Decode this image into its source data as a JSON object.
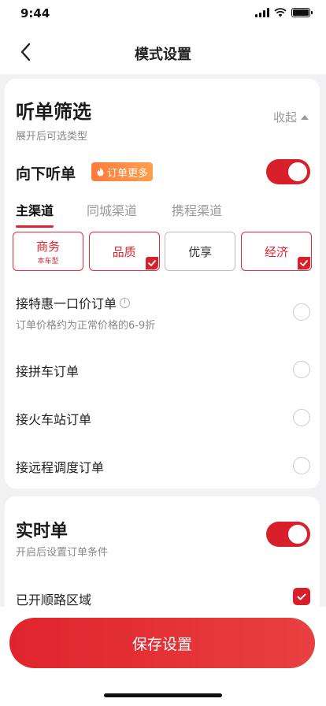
{
  "status_bar": {
    "time": "9:44"
  },
  "header": {
    "title": "模式设置"
  },
  "filter": {
    "title": "听单筛选",
    "subtitle": "展开后可选类型",
    "collapse_label": "收起",
    "down_order_label": "向下听单",
    "more_orders_badge": "订单更多",
    "down_order_on": true,
    "tabs": [
      {
        "label": "主渠道",
        "active": true
      },
      {
        "label": "同城渠道",
        "active": false
      },
      {
        "label": "携程渠道",
        "active": false
      }
    ],
    "car_types": [
      {
        "label": "商务",
        "sub": "本车型",
        "checked": false
      },
      {
        "label": "品质",
        "sub": "",
        "checked": true
      },
      {
        "label": "优享",
        "sub": "",
        "checked": false
      },
      {
        "label": "经济",
        "sub": "",
        "checked": true
      }
    ],
    "options": [
      {
        "label": "接特惠一口价订单",
        "desc": "订单价格约为正常价格的6-9折",
        "checked": false
      },
      {
        "label": "接拼车订单",
        "desc": "",
        "checked": false
      },
      {
        "label": "接火车站订单",
        "desc": "",
        "checked": false
      },
      {
        "label": "接远程调度订单",
        "desc": "",
        "checked": false
      }
    ]
  },
  "realtime": {
    "title": "实时单",
    "subtitle": "开启后设置订单条件",
    "enabled": true,
    "route_area_label": "已开顺路区域",
    "route_area_checked": true
  },
  "footer": {
    "save_label": "保存设置"
  },
  "colors": {
    "accent": "#d8202a",
    "badge": "#ff8a40"
  }
}
